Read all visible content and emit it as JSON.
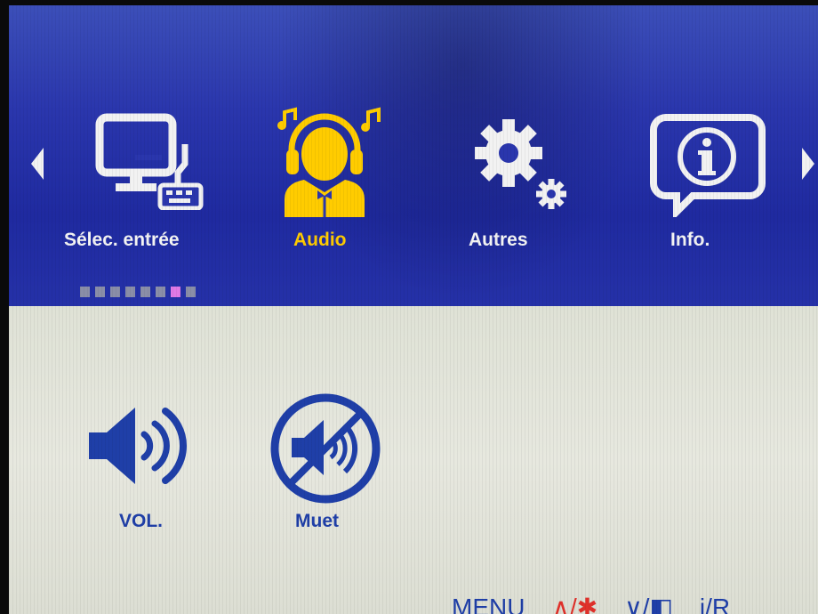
{
  "menu": {
    "items": [
      {
        "label": "Sélec. entrée",
        "icon": "monitor-keyboard-icon",
        "active": false
      },
      {
        "label": "Audio",
        "icon": "headphones-person-icon",
        "active": true
      },
      {
        "label": "Autres",
        "icon": "gears-icon",
        "active": false
      },
      {
        "label": "Info.",
        "icon": "info-bubble-icon",
        "active": false
      }
    ],
    "page_indicator": {
      "count": 8,
      "active_index": 6
    }
  },
  "audio": {
    "items": [
      {
        "label": "VOL.",
        "icon": "speaker-volume-icon"
      },
      {
        "label": "Muet",
        "icon": "mute-icon"
      }
    ]
  },
  "footer": {
    "menu": "MENU",
    "up": "∧/✱",
    "down": "∨/◧",
    "input": "i/R"
  },
  "colors": {
    "header_blue": "#2a36ad",
    "active_yellow": "#ffcc00",
    "item_blue": "#1f3fa8",
    "panel_bg": "#e4e6dc",
    "footer_red": "#e0302a"
  }
}
